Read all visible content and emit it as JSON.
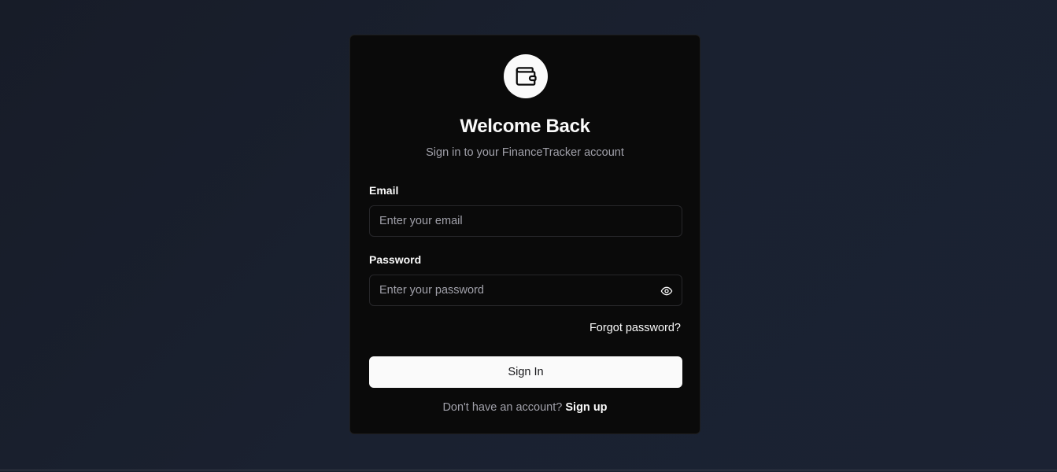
{
  "logo": {
    "icon": "wallet-icon"
  },
  "header": {
    "title": "Welcome Back",
    "subtitle": "Sign in to your FinanceTracker account"
  },
  "form": {
    "email": {
      "label": "Email",
      "value": "",
      "placeholder": "Enter your email"
    },
    "password": {
      "label": "Password",
      "value": "",
      "placeholder": "Enter your password",
      "toggle_icon": "eye-icon"
    },
    "forgot_label": "Forgot password?",
    "submit_label": "Sign In"
  },
  "footer": {
    "prompt": "Don't have an account?",
    "signup_label": "Sign up"
  },
  "colors": {
    "background": "#1a2130",
    "card": "#0a0a0a",
    "primary_text": "#fafafa",
    "muted_text": "#a1a1aa",
    "border": "#27272a"
  }
}
